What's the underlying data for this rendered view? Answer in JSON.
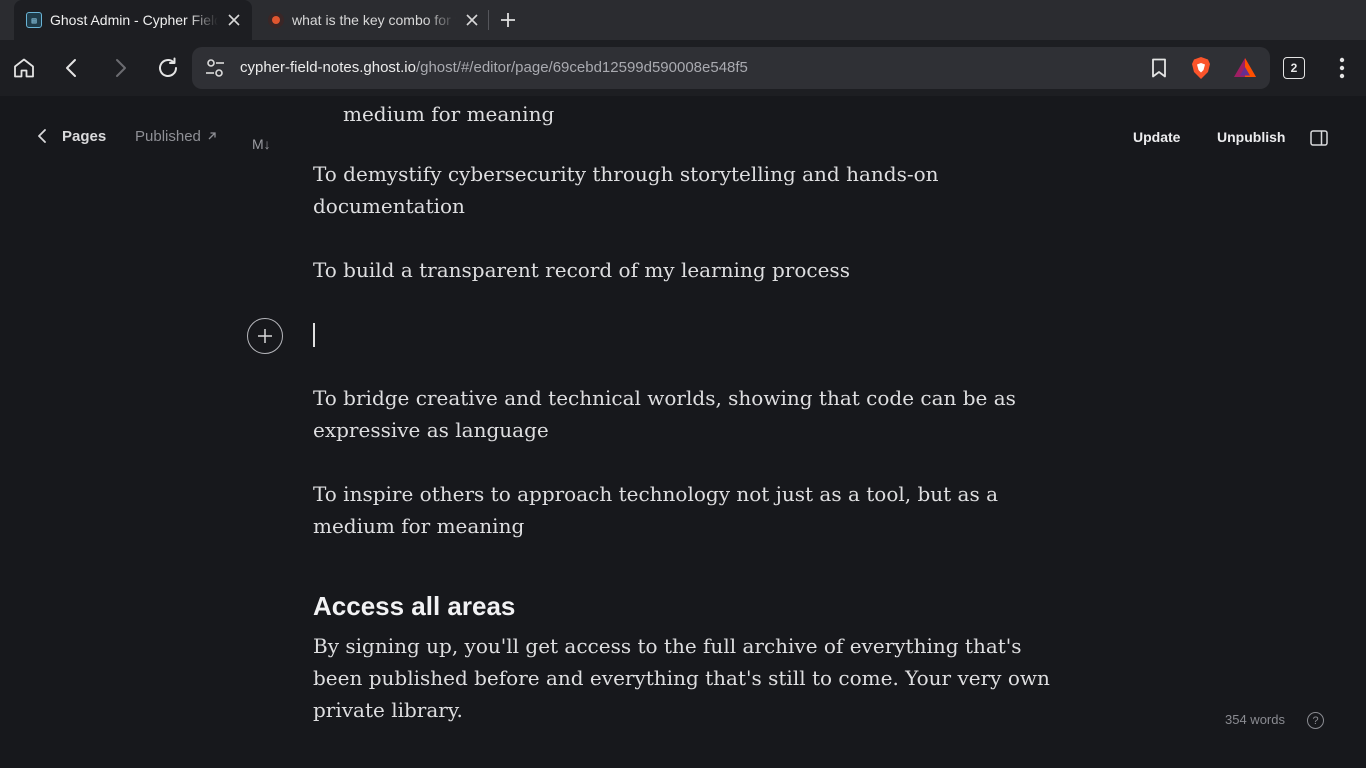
{
  "browser": {
    "tabs": [
      {
        "title": "Ghost Admin - Cypher Field Notes",
        "favicon": "ghost-favicon",
        "active": true
      },
      {
        "title": "what is the key combo for taking a screenshot",
        "favicon": "brave-search-favicon",
        "active": false
      }
    ],
    "url_host": "cypher-field-notes.ghost.io",
    "url_path": "/ghost/#/editor/page/69cebd12599d590008e548f5",
    "tab_count": "2"
  },
  "ghost_header": {
    "back_label": "Pages",
    "status_label": "Published",
    "markdown_label": "M↓",
    "update_label": "Update",
    "unpublish_label": "Unpublish"
  },
  "content": {
    "fragment": "medium for meaning",
    "paragraph_1": "To demystify cybersecurity through storytelling and hands-on documentation",
    "paragraph_2": "To build a transparent record of my learning process",
    "paragraph_3": "To bridge creative and technical worlds, showing that code can be as expressive as language",
    "paragraph_4": "To inspire others to approach technology not just as a tool, but as a medium for meaning",
    "heading": "Access all areas",
    "paragraph_5": "By signing up, you'll get access to the full archive of everything that's been published before and everything that's still to come. Your very own private library."
  },
  "footer": {
    "word_count": "354 words",
    "help": "?"
  },
  "colors": {
    "background": "#17181c",
    "tab_strip": "#2b2c30",
    "toolbar": "#1d1e22",
    "omnibox": "#2f3035",
    "brave_orange": "#fb542b"
  }
}
